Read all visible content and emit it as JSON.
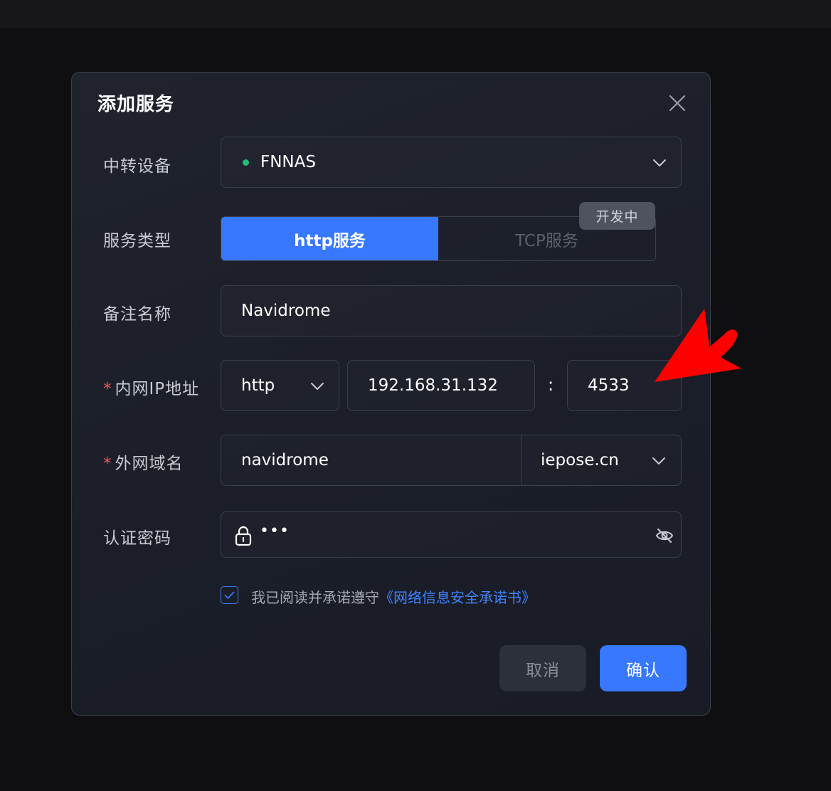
{
  "dialog": {
    "title": "添加服务",
    "relay_device": {
      "label": "中转设备",
      "value": "FNNAS",
      "status_color": "#1fc07a"
    },
    "service_type": {
      "label": "服务类型",
      "options": [
        "http服务",
        "TCP服务"
      ],
      "selected": "http服务",
      "badge": "开发中"
    },
    "remark": {
      "label": "备注名称",
      "value": "Navidrome"
    },
    "intranet": {
      "required_mark": "*",
      "label": "内网IP地址",
      "protocol": "http",
      "ip": "192.168.31.132",
      "separator": ":",
      "port": "4533"
    },
    "domain": {
      "required_mark": "*",
      "label": "外网域名",
      "subdomain": "navidrome",
      "suffix": "iepose.cn"
    },
    "password": {
      "label": "认证密码",
      "value": "•••"
    },
    "agreement": {
      "checked": true,
      "text": "我已阅读并承诺遵守",
      "link": "《网络信息安全承诺书》"
    },
    "buttons": {
      "cancel": "取消",
      "confirm": "确认"
    }
  },
  "colors": {
    "accent": "#3778ff",
    "required": "#f25a5a",
    "annotation_arrow": "#ff0000"
  }
}
